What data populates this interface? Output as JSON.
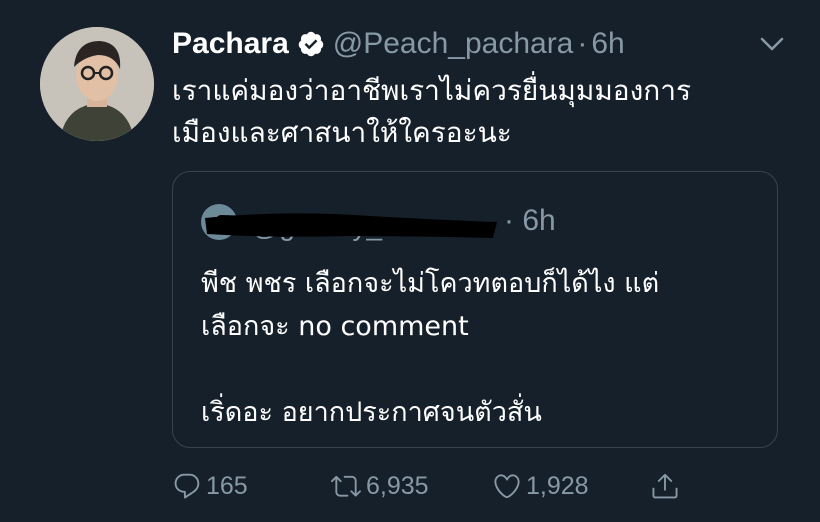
{
  "tweet": {
    "display_name": "Pachara",
    "verified_icon": "verified-badge-icon",
    "handle": "@Peach_pachara",
    "separator": "·",
    "time": "6h",
    "text_lines": [
      "เราแค่มองว่าอาชีพเราไม่ควรยื่นมุมมองการ",
      "เมืองและศาสนาให้ใครอะนะ"
    ]
  },
  "quote": {
    "handle_partial": "@g      li   t   l  y_",
    "separator": "·",
    "time": "6h",
    "text_lines": [
      "พีช พชร เลือกจะไม่โควทตอบก็ได้ไง แต่",
      "เลือกจะ no comment",
      "",
      "เริ่ดอะ อยากประกาศจนตัวสั่น"
    ]
  },
  "actions": {
    "reply_count": "165",
    "retweet_count": "6,935",
    "like_count": "1,928"
  },
  "colors": {
    "background": "#15202b",
    "secondary_text": "#8899a6",
    "border": "#38444d"
  }
}
